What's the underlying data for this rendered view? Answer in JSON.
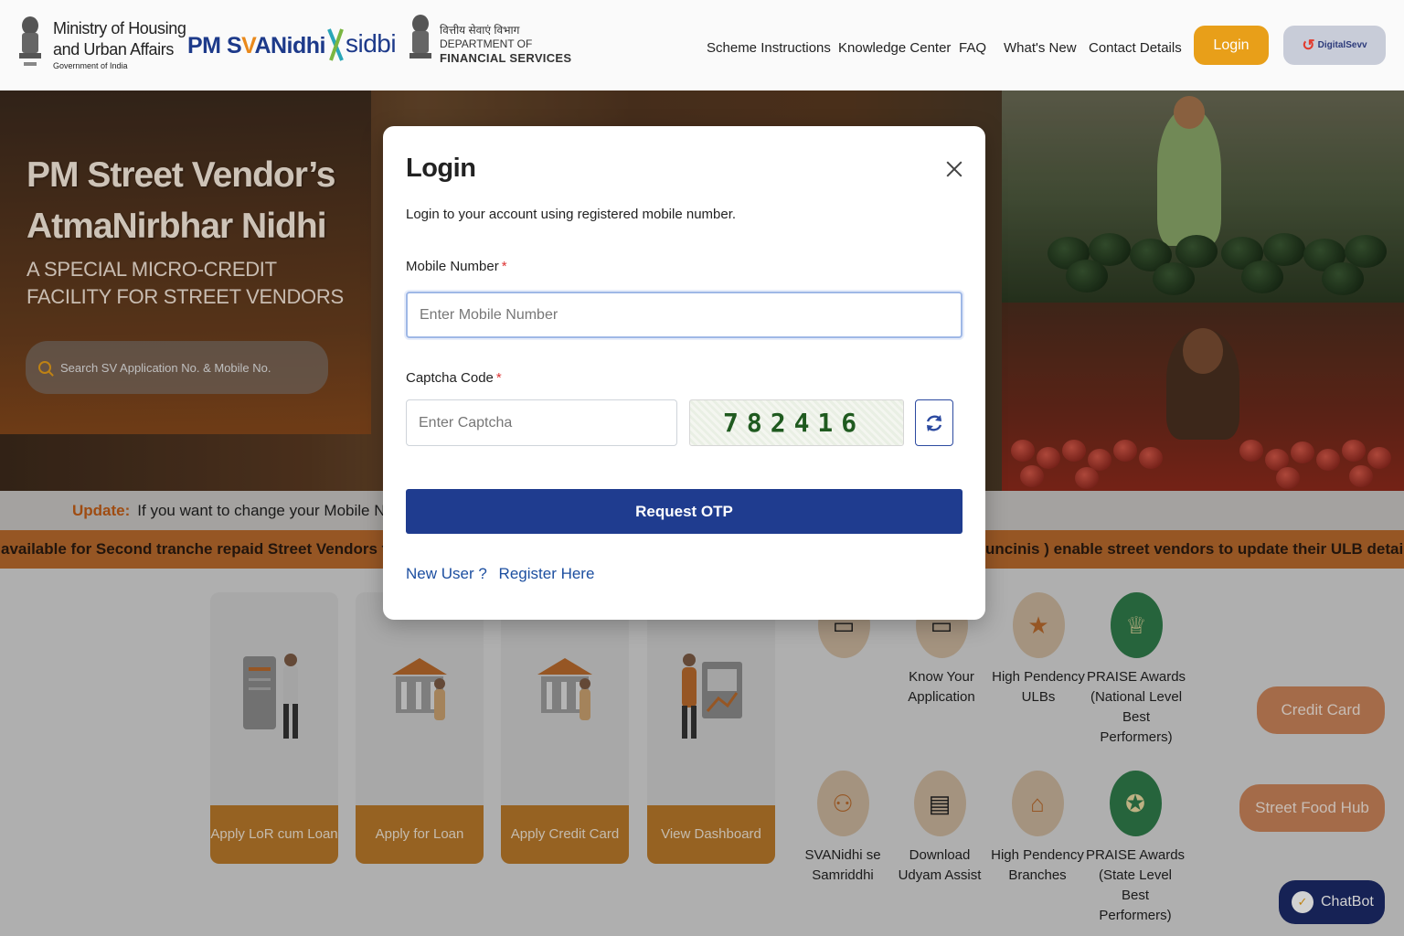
{
  "header": {
    "ministry_line1": "Ministry of Housing",
    "ministry_line2": "and Urban Affairs",
    "ministry_sub": "Government of India",
    "brand_prefix": "PM S",
    "brand_v": "V",
    "brand_suffix": "ANidhi",
    "sidbi": "sidbi",
    "dfs_hindi": "वित्तीय सेवाएं विभाग",
    "dfs_line1": "DEPARTMENT OF",
    "dfs_line2": "FINANCIAL SERVICES",
    "nav": [
      "Scheme Instructions",
      "Knowledge Center",
      "FAQ",
      "What's New",
      "Contact Details"
    ],
    "login_label": "Login",
    "digisevv_label": "DigitalSevv"
  },
  "hero": {
    "title": "PM Street Vendor’s AtmaNirbhar Nidhi",
    "subtitle": "A SPECIAL MICRO-CREDIT FACILITY FOR STREET VENDORS",
    "search_placeholder": "Search SV Application No. & Mobile No."
  },
  "update": {
    "label": "Update:",
    "text": "If you want to change your Mobile Numb"
  },
  "ticker": {
    "left": "available for Second tranche repaid Street Vendors to enhanc",
    "right": "uncinis ) enable street vendors to update their ULB details in case"
  },
  "cards": [
    {
      "label": "Apply LoR cum Loan"
    },
    {
      "label": "Apply for Loan"
    },
    {
      "label": "Apply Credit Card"
    },
    {
      "label": "View Dashboard"
    }
  ],
  "services": [
    {
      "label": "",
      "icon": "monitor-icon"
    },
    {
      "label": "Know Your Application",
      "icon": "monitor-icon"
    },
    {
      "label": "High Pendency ULBs",
      "icon": "star-icon"
    },
    {
      "label": "PRAISE Awards (National Level Best Performers)",
      "icon": "trophy-icon"
    },
    {
      "label": "SVANidhi se Samriddhi",
      "icon": "family-icon"
    },
    {
      "label": "Download Udyam Assist",
      "icon": "document-icon"
    },
    {
      "label": "High Pendency Branches",
      "icon": "bank-icon"
    },
    {
      "label": "PRAISE Awards (State Level Best Performers)",
      "icon": "medal-icon"
    }
  ],
  "side_buttons": {
    "credit_card": "Credit Card",
    "street_food_hub": "Street Food Hub",
    "chatbot": "ChatBot"
  },
  "modal": {
    "title": "Login",
    "description": "Login to your account using registered mobile number.",
    "mobile_label": "Mobile Number",
    "mobile_placeholder": "Enter Mobile Number",
    "captcha_label": "Captcha Code",
    "captcha_placeholder": "Enter Captcha",
    "captcha_value": "782416",
    "submit_label": "Request OTP",
    "new_user": "New User ?",
    "register": "Register Here",
    "required_mark": "*"
  },
  "colors": {
    "primary": "#1f3c8f",
    "accent": "#e89f19",
    "required": "#dd3333"
  }
}
